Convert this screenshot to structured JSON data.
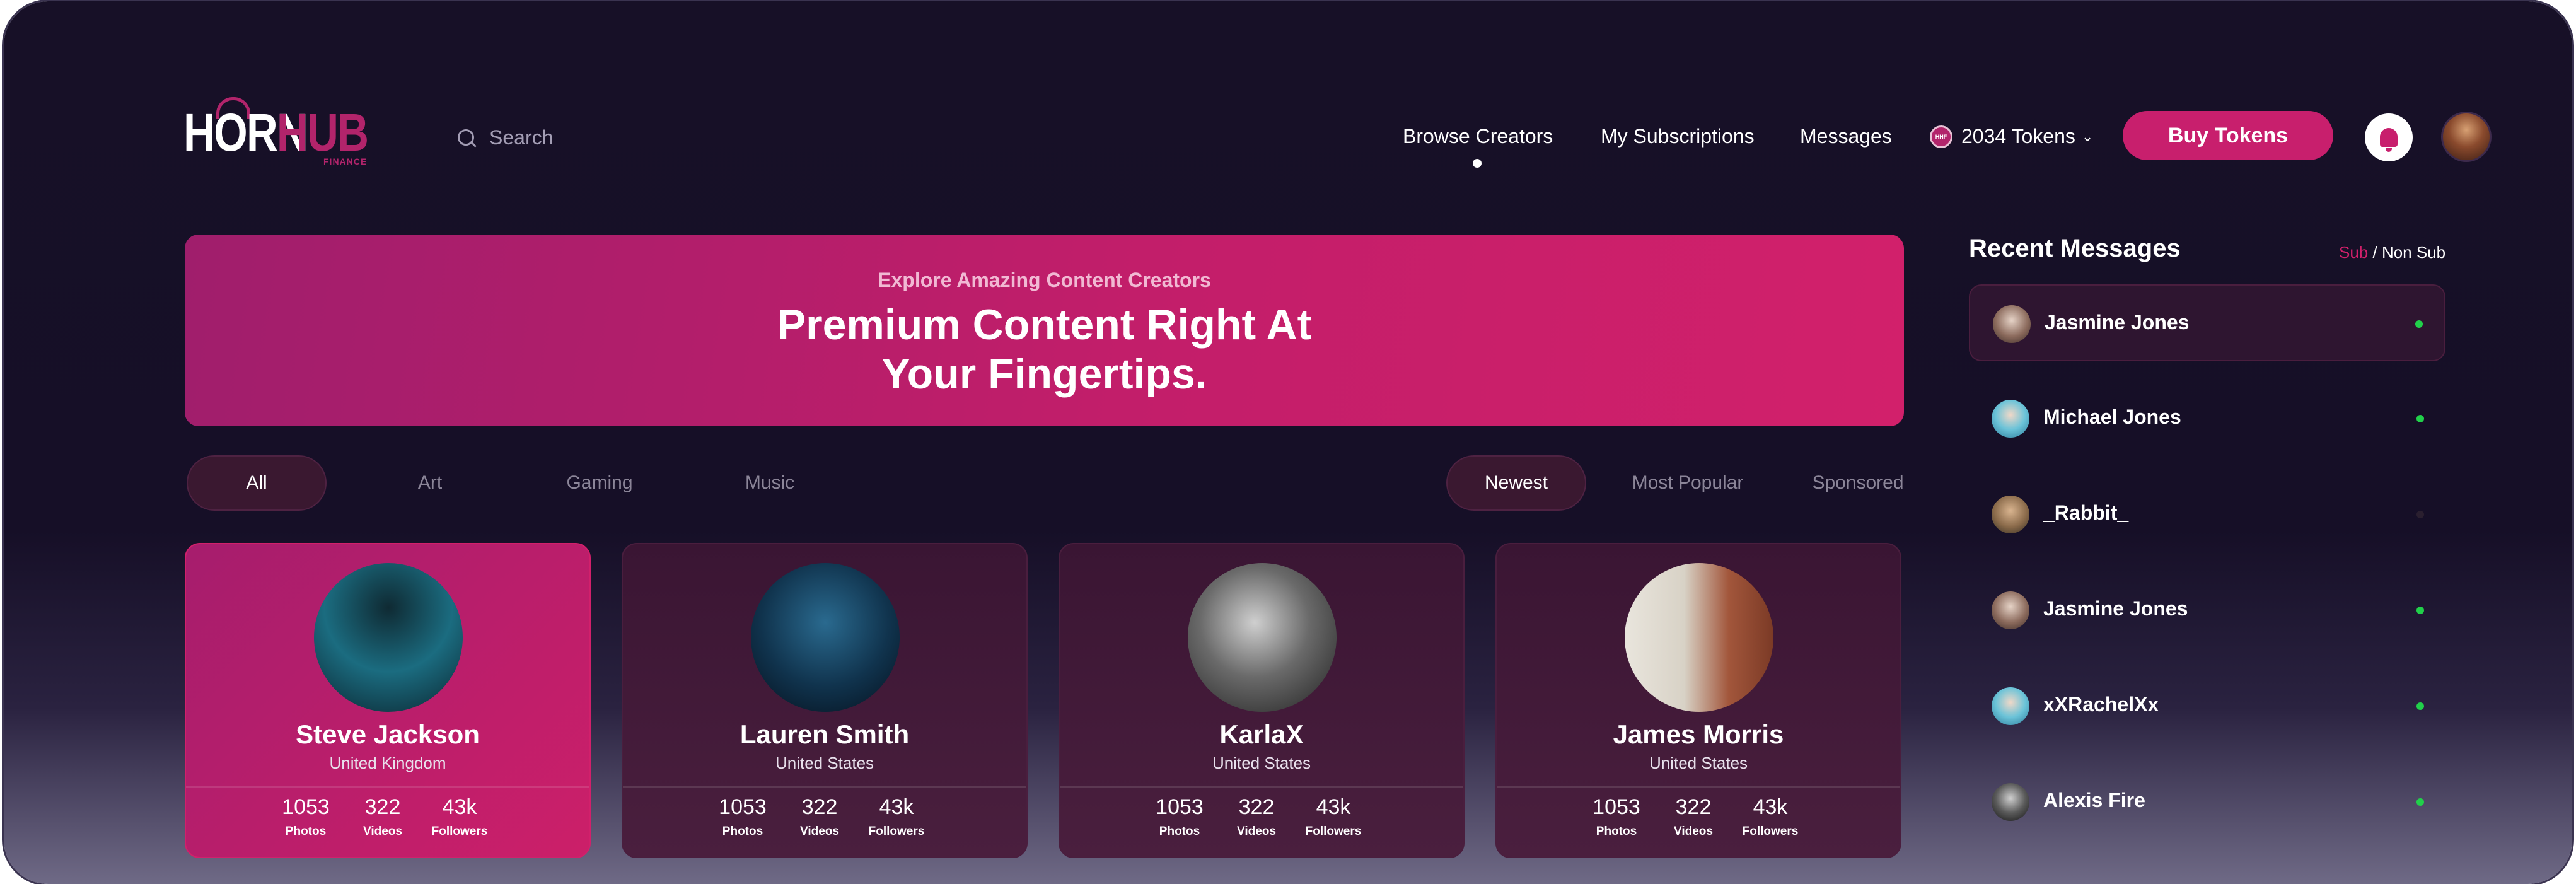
{
  "brand": {
    "name_part1": "HORN",
    "name_part2": "HUB",
    "tagline": "FINANCE"
  },
  "search": {
    "placeholder": "Search",
    "icon": "search-icon"
  },
  "nav": {
    "items": [
      "Browse Creators",
      "My Subscriptions",
      "Messages"
    ],
    "active": "Browse Creators"
  },
  "tokens": {
    "label": "2034 Tokens",
    "icon": "token-coin-icon",
    "coin_text": "HHF"
  },
  "buy_button": {
    "label": "Buy Tokens"
  },
  "icons": {
    "bell": "bell-icon",
    "chevron": "chevron-down-icon"
  },
  "hero": {
    "subtitle": "Explore Amazing Content Creators",
    "title_line1": "Premium Content Right At",
    "title_line2": "Your Fingertips."
  },
  "category_tabs": [
    "All",
    "Art",
    "Gaming",
    "Music"
  ],
  "sort_tabs": [
    "Newest",
    "Most Popular",
    "Sponsored"
  ],
  "creators": [
    {
      "name": "Steve Jackson",
      "location": "United Kingdom",
      "photos": "1053",
      "videos": "322",
      "followers": "43k"
    },
    {
      "name": "Lauren Smith",
      "location": "United States",
      "photos": "1053",
      "videos": "322",
      "followers": "43k"
    },
    {
      "name": "KarlaX",
      "location": "United States",
      "photos": "1053",
      "videos": "322",
      "followers": "43k"
    },
    {
      "name": "James Morris",
      "location": "United States",
      "photos": "1053",
      "videos": "322",
      "followers": "43k"
    }
  ],
  "stat_labels": {
    "photos": "Photos",
    "videos": "Videos",
    "followers": "Followers"
  },
  "recent_messages": {
    "title": "Recent Messages",
    "toggle_sub": "Sub",
    "toggle_sep": " / ",
    "toggle_nonsub": "Non Sub",
    "items": [
      {
        "name": "Jasmine Jones",
        "online": true
      },
      {
        "name": "Michael Jones",
        "online": true
      },
      {
        "name": "_Rabbit_",
        "online": false
      },
      {
        "name": "Jasmine Jones",
        "online": true
      },
      {
        "name": "xXRachelXx",
        "online": true
      },
      {
        "name": "Alexis Fire",
        "online": true
      }
    ]
  },
  "colors": {
    "accent": "#c81f6d",
    "background": "#171027",
    "online": "#21d04a"
  }
}
